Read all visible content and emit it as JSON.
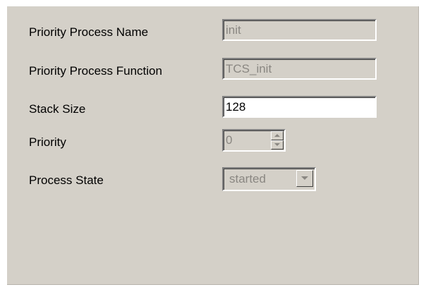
{
  "form": {
    "process_name": {
      "label": "Priority Process Name",
      "value": "init",
      "enabled": false
    },
    "process_function": {
      "label": "Priority Process Function",
      "value": "TCS_init",
      "enabled": false
    },
    "stack_size": {
      "label": "Stack Size",
      "value": "128",
      "enabled": true
    },
    "priority": {
      "label": "Priority",
      "value": "0",
      "enabled": false
    },
    "process_state": {
      "label": "Process State",
      "value": "started",
      "enabled": false
    }
  },
  "icons": {
    "spin_up": "spin-up-arrow-icon",
    "spin_down": "spin-down-arrow-icon",
    "dropdown": "chevron-down-icon"
  },
  "colors": {
    "panel_background": "#d4d0c8",
    "disabled_text": "#8a8782",
    "enabled_field_background": "#ffffff"
  }
}
